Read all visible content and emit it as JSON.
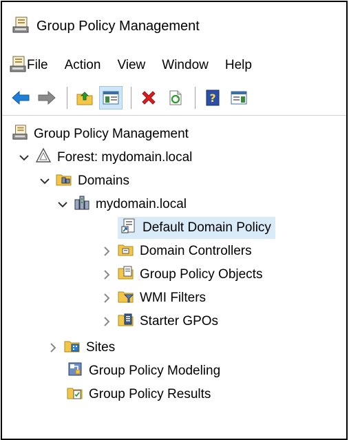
{
  "window": {
    "title": "Group Policy Management"
  },
  "menu": {
    "items": [
      "File",
      "Action",
      "View",
      "Window",
      "Help"
    ]
  },
  "tree": {
    "root": "Group Policy Management",
    "forest": "Forest: mydomain.local",
    "domains": "Domains",
    "domain": "mydomain.local",
    "default_policy": "Default Domain Policy",
    "domain_controllers": "Domain Controllers",
    "gpo": "Group Policy Objects",
    "wmi": "WMI Filters",
    "starter": "Starter GPOs",
    "sites": "Sites",
    "modeling": "Group Policy Modeling",
    "results": "Group Policy Results"
  },
  "colors": {
    "selection": "#d9ebf9",
    "arrow_blue": "#1f7fd6",
    "delete_red": "#d81e1e",
    "refresh_green": "#2c9a2c",
    "folder_yellow": "#f2c649"
  }
}
